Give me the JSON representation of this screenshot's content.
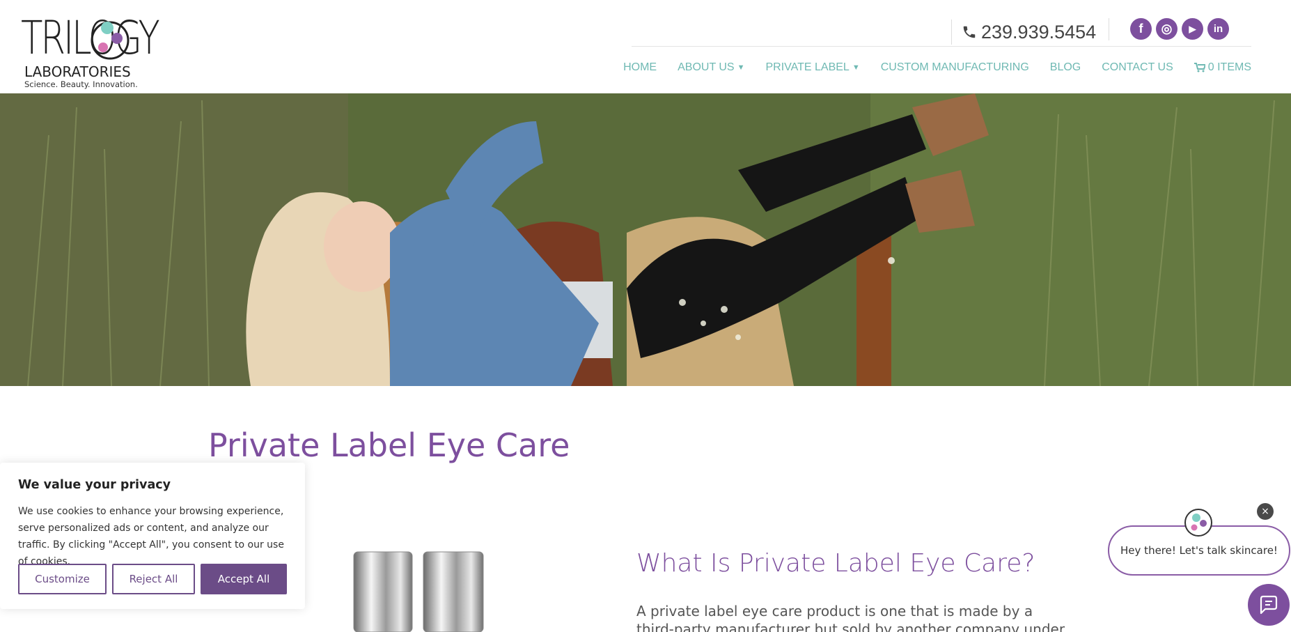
{
  "brand": {
    "logo_word": "TRILOGY",
    "logo_sub": "LABORATORIES",
    "logo_tagline": "Science. Beauty. Innovation.",
    "accent": "#7d4f9e",
    "nav_color": "#6fb9b3"
  },
  "header": {
    "phone": "239.939.5454",
    "social": [
      {
        "name": "facebook",
        "glyph": "f"
      },
      {
        "name": "map-pin",
        "glyph": "◎"
      },
      {
        "name": "youtube",
        "glyph": "▶"
      },
      {
        "name": "linkedin",
        "glyph": "in"
      }
    ]
  },
  "nav": {
    "items": [
      {
        "label": "HOME",
        "dropdown": false
      },
      {
        "label": "ABOUT US",
        "dropdown": true
      },
      {
        "label": "PRIVATE LABEL",
        "dropdown": true
      },
      {
        "label": "CUSTOM MANUFACTURING",
        "dropdown": false
      },
      {
        "label": "BLOG",
        "dropdown": false
      },
      {
        "label": "CONTACT US",
        "dropdown": false
      },
      {
        "label": "0 ITEMS",
        "dropdown": false
      }
    ]
  },
  "main": {
    "page_title": "Private Label Eye Care",
    "section_title": "What Is Private Label Eye Care?",
    "section_body": "A private label eye care product is one that is made by a third-party manufacturer but sold by another company under their own"
  },
  "cookie": {
    "title": "We value your privacy",
    "text": "We use cookies to enhance your browsing experience, serve personalized ads or content, and analyze our traffic. By clicking \"Accept All\", you consent to our use of cookies.",
    "customize_label": "Customize",
    "reject_label": "Reject All",
    "accept_label": "Accept All"
  },
  "chat": {
    "greeting": "Hey there! Let's talk skincare!",
    "close_glyph": "×"
  }
}
